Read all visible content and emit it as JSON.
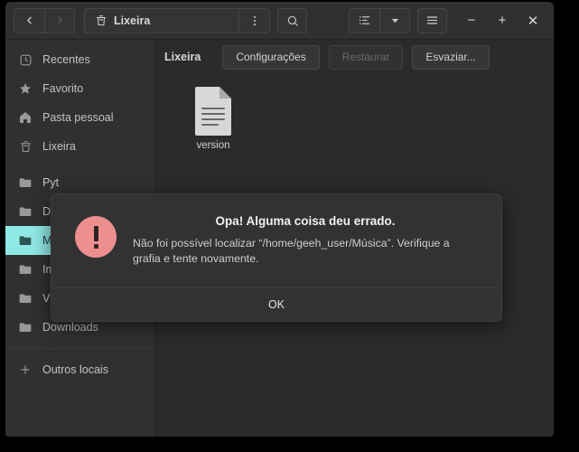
{
  "window": {
    "title": "Lixeira",
    "titlebar": {
      "back_label": "Voltar",
      "forward_label": "Avançar",
      "path_label": "Lixeira",
      "path_icon": "trash-icon",
      "menu_icon": "three-dots-vertical-icon",
      "search_icon": "search-icon",
      "view_list_icon": "view-list-icon",
      "view_dropdown_icon": "chevron-down-icon",
      "hamburger_icon": "hamburger-menu-icon",
      "minimize_label": "−",
      "maximize_label": "+",
      "close_label": "✕"
    }
  },
  "sidebar": {
    "items": [
      {
        "label": "Recentes",
        "icon": "clock-icon",
        "selected": false
      },
      {
        "label": "Favorito",
        "icon": "star-icon",
        "selected": false
      },
      {
        "label": "Pasta pessoal",
        "icon": "home-icon",
        "selected": false
      },
      {
        "label": "Lixeira",
        "icon": "trash-icon",
        "selected": false
      },
      {
        "label": "Pyt",
        "icon": "folder-icon",
        "selected": false
      },
      {
        "label": "Doc",
        "icon": "folder-icon",
        "selected": false
      },
      {
        "label": "Mús",
        "icon": "folder-icon",
        "selected": true
      },
      {
        "label": "Ima",
        "icon": "folder-icon",
        "selected": false
      },
      {
        "label": "Vídeos",
        "icon": "folder-icon",
        "selected": false
      },
      {
        "label": "Downloads",
        "icon": "folder-icon",
        "selected": false
      },
      {
        "label": "Outros locais",
        "icon": "plus-icon",
        "selected": false
      }
    ]
  },
  "toolbar": {
    "location_label": "Lixeira",
    "settings_label": "Configurações",
    "restore_label": "Restaurar",
    "restore_disabled": true,
    "empty_label": "Esvaziar..."
  },
  "files": [
    {
      "name": "version",
      "icon": "text-document-icon"
    }
  ],
  "dialog": {
    "icon": "error-exclamation-icon",
    "title": "Opa! Alguma coisa deu errado.",
    "message": "Não foi possível localizar “/home/geeh_user/Música”. Verifique a grafia e tente novamente.",
    "ok_label": "OK"
  },
  "colors": {
    "selection": "#90e8e4",
    "error_icon": "#ee8f8f",
    "window_bg": "#2b2b2b",
    "sidebar_bg": "#303030",
    "header_bg": "#303030",
    "dialog_bg": "#323232"
  }
}
